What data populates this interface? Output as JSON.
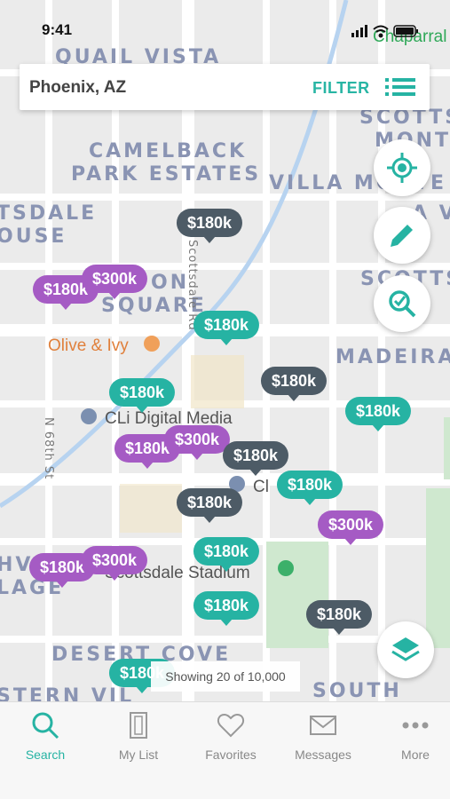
{
  "status_bar": {
    "time": "9:41"
  },
  "search": {
    "location": "Phoenix, AZ",
    "filter_label": "FILTER"
  },
  "map_labels": {
    "chaparral": "Chaparral",
    "quail_vista": "QUAIL VISTA",
    "scotts_monte": "SCOTTS MONTE",
    "camelback_1": "CAMELBACK",
    "camelback_2": "PARK ESTATES",
    "villa_monte": "VILLA MONTE",
    "tsdale": "TSDALE",
    "ouse": "OUSE",
    "a_v": "A V",
    "scotts_2": "SCOTTS",
    "on_square_1": "ON",
    "on_square_2": "SQUARE",
    "madeira": "MADEIRA",
    "olive_ivy": "Olive & Ivy",
    "cli_media": "CLi Digital Media",
    "cli_2": "Cl",
    "stadium": "Scottsdale Stadium",
    "hv": "HV",
    "lage": "LAGE",
    "desert_cove": "DESERT COVE",
    "south": "SOUTH",
    "stern_vil": "STERN VIL",
    "scottsdale_rd": "Scottsdale Rd",
    "n68th": "N 68th St"
  },
  "pins": [
    {
      "price": "$180k",
      "color": "dark"
    },
    {
      "price": "$180k",
      "color": "purple"
    },
    {
      "price": "$300k",
      "color": "purple"
    },
    {
      "price": "$180k",
      "color": "teal"
    },
    {
      "price": "$180k",
      "color": "dark"
    },
    {
      "price": "$180k",
      "color": "teal"
    },
    {
      "price": "$180k",
      "color": "teal"
    },
    {
      "price": "$180k",
      "color": "purple"
    },
    {
      "price": "$300k",
      "color": "purple"
    },
    {
      "price": "$180k",
      "color": "dark"
    },
    {
      "price": "$180k",
      "color": "teal"
    },
    {
      "price": "$180k",
      "color": "dark"
    },
    {
      "price": "$300k",
      "color": "purple"
    },
    {
      "price": "$180k",
      "color": "purple"
    },
    {
      "price": "$300k",
      "color": "purple"
    },
    {
      "price": "$180k",
      "color": "teal"
    },
    {
      "price": "$180k",
      "color": "teal"
    },
    {
      "price": "$180k",
      "color": "dark"
    },
    {
      "price": "$180k",
      "color": "teal"
    }
  ],
  "showing_text": "Showing 20 of 10,000",
  "nav": [
    {
      "label": "Search",
      "icon": "search-icon",
      "active": true
    },
    {
      "label": "My List",
      "icon": "door-icon",
      "active": false
    },
    {
      "label": "Favorites",
      "icon": "heart-icon",
      "active": false
    },
    {
      "label": "Messages",
      "icon": "mail-icon",
      "active": false
    },
    {
      "label": "More",
      "icon": "more-dots-icon",
      "active": false
    }
  ],
  "colors": {
    "teal": "#26b3a3",
    "purple": "#a55bc4",
    "dark": "#4d5b66"
  }
}
